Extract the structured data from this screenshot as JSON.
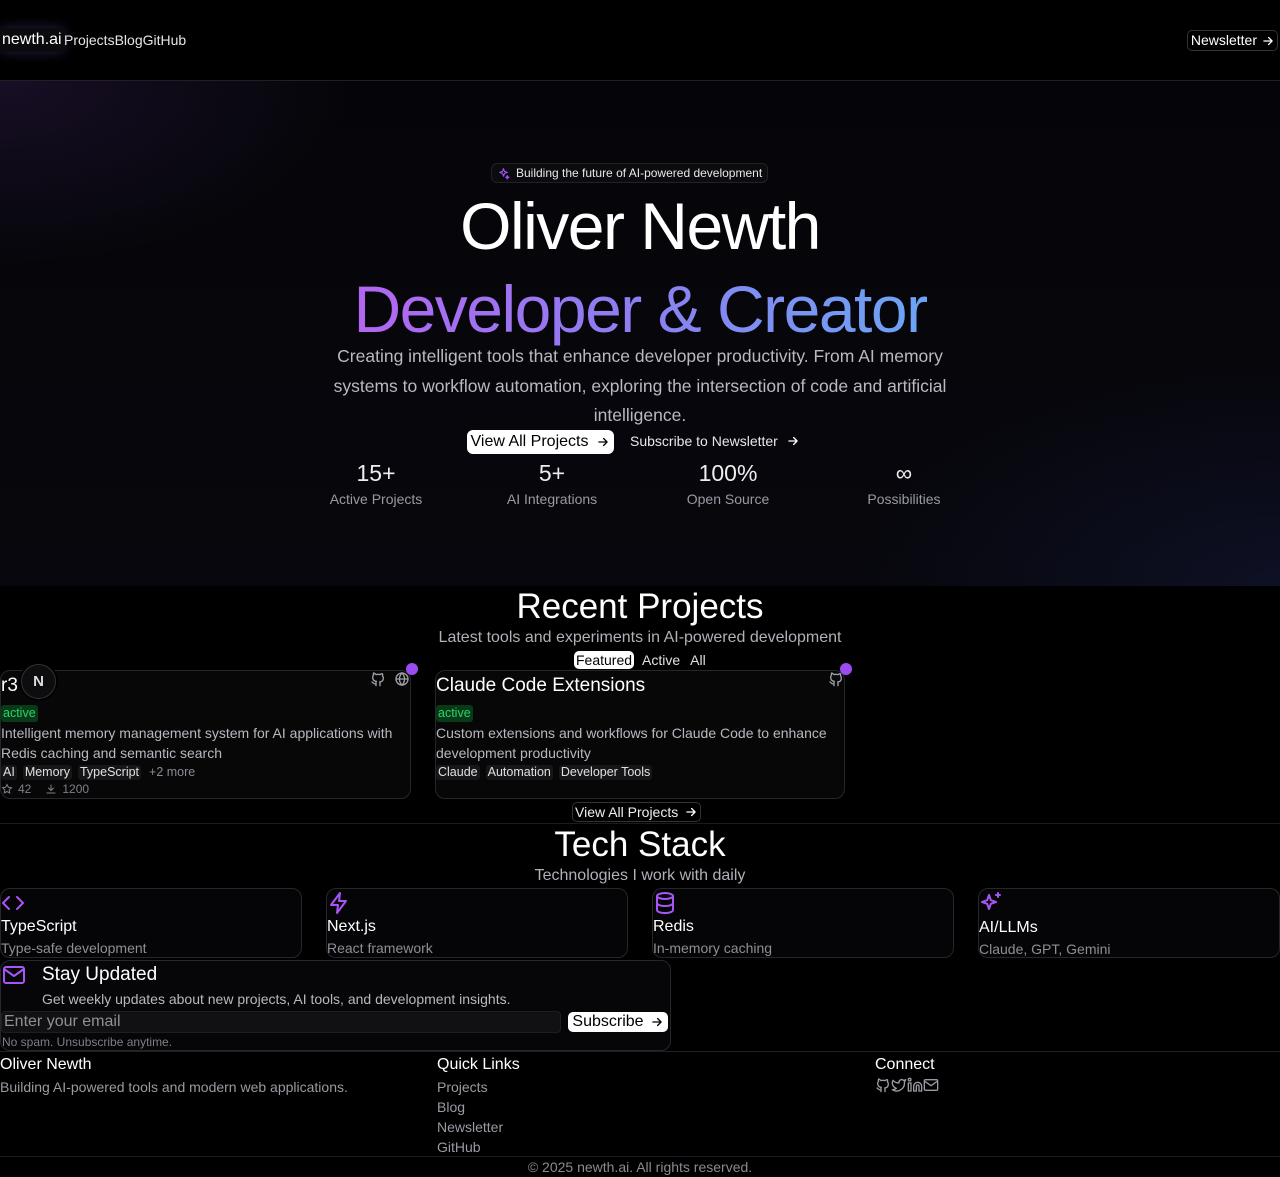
{
  "nav": {
    "brand": "newth.ai",
    "links": [
      "Projects",
      "Blog",
      "GitHub"
    ],
    "newsletter": "Newsletter"
  },
  "hero": {
    "pill": "Building the future of AI-powered development",
    "title": "Oliver Newth",
    "subtitle": "Developer & Creator",
    "description": "Creating intelligent tools that enhance developer productivity. From AI memory systems to workflow automation, exploring the intersection of code and artificial intelligence.",
    "primary_button": "View All Projects",
    "secondary_button": "Subscribe to Newsletter",
    "stats": [
      {
        "value": "15+",
        "label": "Active Projects"
      },
      {
        "value": "5+",
        "label": "AI Integrations"
      },
      {
        "value": "100%",
        "label": "Open Source"
      },
      {
        "value": "∞",
        "label": "Possibilities"
      }
    ]
  },
  "projects": {
    "title": "Recent Projects",
    "subtitle": "Latest tools and experiments in AI-powered development",
    "filters": [
      "Featured",
      "Active",
      "All"
    ],
    "cards": [
      {
        "title": "r3",
        "status": "active",
        "description": "Intelligent memory management system for AI applications with Redis caching and semantic search",
        "tags": [
          "AI",
          "Memory",
          "TypeScript"
        ],
        "more": "+2 more",
        "stars": "42",
        "downloads": "1200"
      },
      {
        "title": "Claude Code Extensions",
        "status": "active",
        "description": "Custom extensions and workflows for Claude Code to enhance development productivity",
        "tags": [
          "Claude",
          "Automation",
          "Developer Tools"
        ]
      }
    ],
    "view_all": "View All Projects",
    "avatar_letter": "N"
  },
  "tech": {
    "title": "Tech Stack",
    "subtitle": "Technologies I work with daily",
    "items": [
      {
        "name": "TypeScript",
        "desc": "Type-safe development",
        "icon": "code-icon"
      },
      {
        "name": "Next.js",
        "desc": "React framework",
        "icon": "zap-icon"
      },
      {
        "name": "Redis",
        "desc": "In-memory caching",
        "icon": "database-icon"
      },
      {
        "name": "AI/LLMs",
        "desc": "Claude, GPT, Gemini",
        "icon": "sparkles-icon"
      }
    ]
  },
  "newsletter": {
    "title": "Stay Updated",
    "text": "Get weekly updates about new projects, AI tools, and development insights.",
    "placeholder": "Enter your email",
    "button": "Subscribe",
    "fine": "No spam. Unsubscribe anytime."
  },
  "footer": {
    "name": "Oliver Newth",
    "tagline": "Building AI-powered tools and modern web applications.",
    "quick_title": "Quick Links",
    "quick_links": [
      "Projects",
      "Blog",
      "Newsletter",
      "GitHub"
    ],
    "connect_title": "Connect",
    "copyright": "© 2025 newth.ai. All rights reserved."
  },
  "colors": {
    "accent": "#a855f7",
    "gradient_start": "#b366f0",
    "gradient_end": "#6aa5f4",
    "status_green": "#2bd36a"
  }
}
